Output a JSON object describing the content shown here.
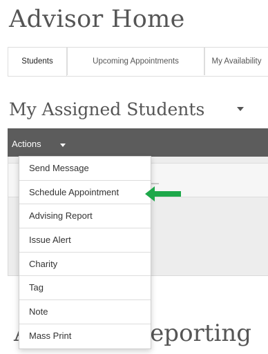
{
  "page": {
    "title": "Advisor Home"
  },
  "tabs": [
    {
      "label": "Students",
      "active": true
    },
    {
      "label": "Upcoming Appointments",
      "active": false
    },
    {
      "label": "My Availability",
      "active": false
    }
  ],
  "section": {
    "title": "My Assigned Students"
  },
  "panel": {
    "actions_label": "Actions"
  },
  "actions_menu": {
    "items": [
      {
        "label": "Send Message"
      },
      {
        "label": "Schedule Appointment"
      },
      {
        "label": "Advising Report"
      },
      {
        "label": "Issue Alert"
      },
      {
        "label": "Charity"
      },
      {
        "label": "Tag"
      },
      {
        "label": "Note"
      },
      {
        "label": "Mass Print"
      }
    ]
  },
  "bottom_section": {
    "partial_title_left": "A",
    "partial_title_right": "eporting"
  },
  "colors": {
    "toolbar": "#5c5c5c",
    "highlight_arrow": "#1ea84a"
  },
  "icons": {
    "pointer": "arrow-left-icon"
  }
}
